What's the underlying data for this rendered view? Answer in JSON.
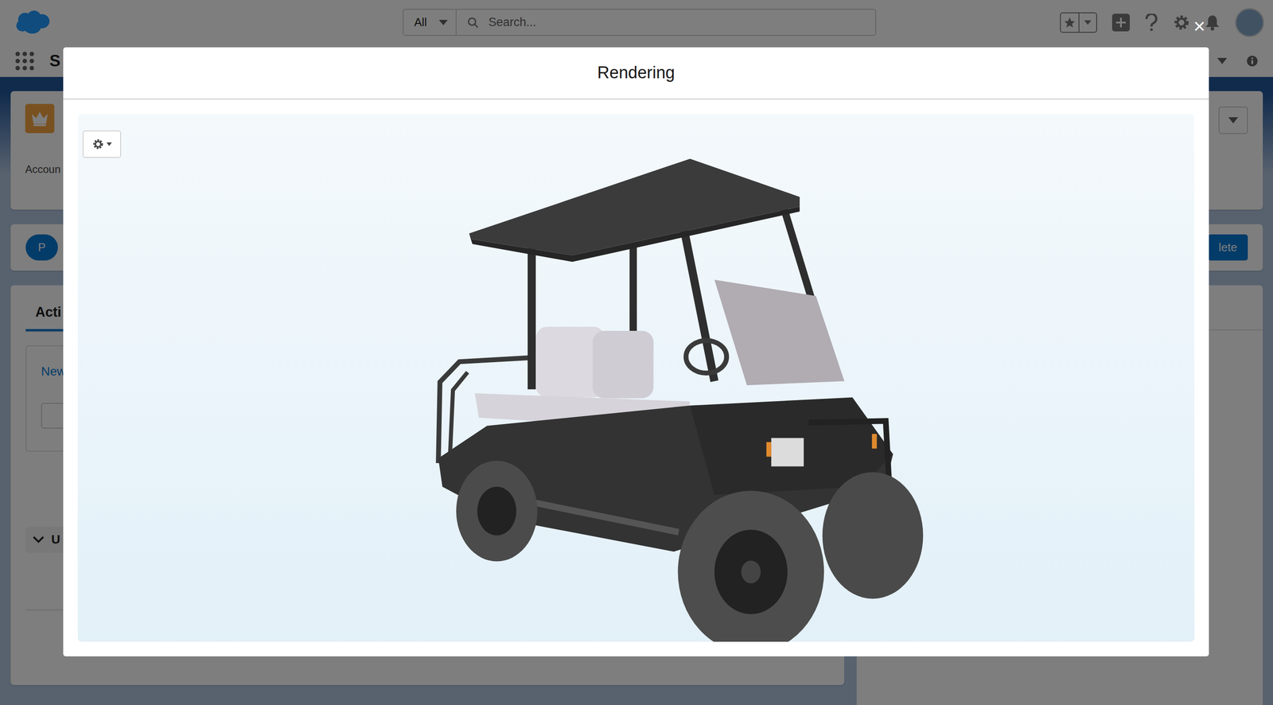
{
  "header": {
    "search_scope": "All",
    "search_placeholder": "Search...",
    "app_name": "S"
  },
  "record": {
    "field_label": "Accoun",
    "primary_button": "P",
    "delete_button": "lete"
  },
  "activity": {
    "tab": "Acti",
    "tab_selected": true,
    "new_link": "New",
    "section": "U",
    "section_expanded": true
  },
  "modal": {
    "title": "Rendering",
    "close": "×"
  }
}
